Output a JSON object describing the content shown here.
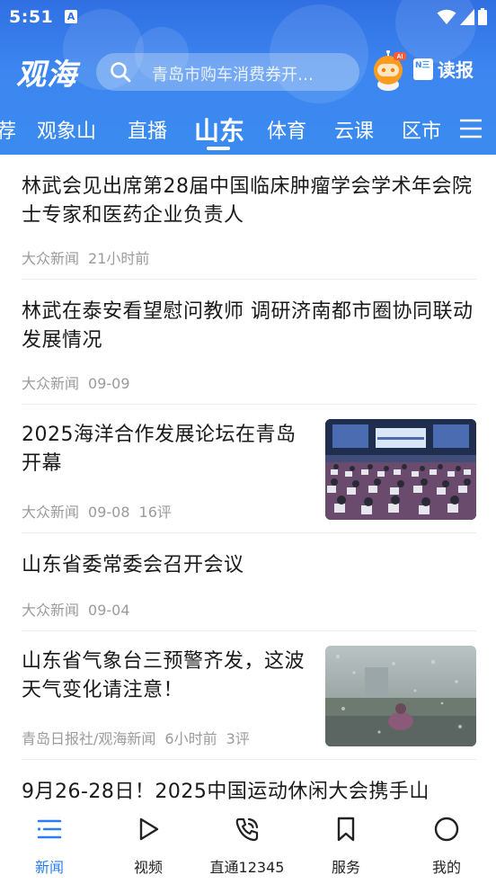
{
  "status_bar": {
    "time": "5:51",
    "notification_letter": "A"
  },
  "header": {
    "logo": "观海",
    "search_placeholder": "青岛市购车消费券开…",
    "read_paper_badge": "N三",
    "read_paper_label": "读报",
    "robot_badge": "AI"
  },
  "tabs": [
    {
      "label": "荐",
      "active": false
    },
    {
      "label": "观象山",
      "active": false
    },
    {
      "label": "直播",
      "active": false
    },
    {
      "label": "山东",
      "active": true
    },
    {
      "label": "体育",
      "active": false
    },
    {
      "label": "云课",
      "active": false
    },
    {
      "label": "区市",
      "active": false
    }
  ],
  "articles": [
    {
      "title": "林武会见出席第28届中国临床肿瘤学会学术年会院士专家和医药企业负责人",
      "source": "大众新闻",
      "time": "21小时前",
      "comments": ""
    },
    {
      "title": "林武在泰安看望慰问教师 调研济南都市圈协同联动发展情况",
      "source": "大众新闻",
      "time": "09-09",
      "comments": ""
    },
    {
      "title": "2025海洋合作发展论坛在青岛开幕",
      "source": "大众新闻",
      "time": "09-08",
      "comments": "16评",
      "image": "conference-hall-photo"
    },
    {
      "title": "山东省委常委会召开会议",
      "source": "大众新闻",
      "time": "09-04",
      "comments": ""
    },
    {
      "title": "山东省气象台三预警齐发，这波天气变化请注意！",
      "source": "青岛日报社/观海新闻",
      "time": "6小时前",
      "comments": "3评",
      "image": "rainy-street-photo"
    },
    {
      "title": "9月26-28日！2025中国运动休闲大会携手山",
      "source": "",
      "time": "",
      "comments": ""
    }
  ],
  "bottom_nav": [
    {
      "label": "新闻",
      "icon": "news-list-icon",
      "active": true
    },
    {
      "label": "视频",
      "icon": "play-icon",
      "active": false
    },
    {
      "label": "直通12345",
      "icon": "phone-call-icon",
      "active": false
    },
    {
      "label": "服务",
      "icon": "bookmark-icon",
      "active": false
    },
    {
      "label": "我的",
      "icon": "profile-circle-icon",
      "active": false
    }
  ],
  "colors": {
    "header_blue": "#3a8bf0",
    "active_blue": "#2c7cf5",
    "meta_gray": "#9b9b9b"
  }
}
